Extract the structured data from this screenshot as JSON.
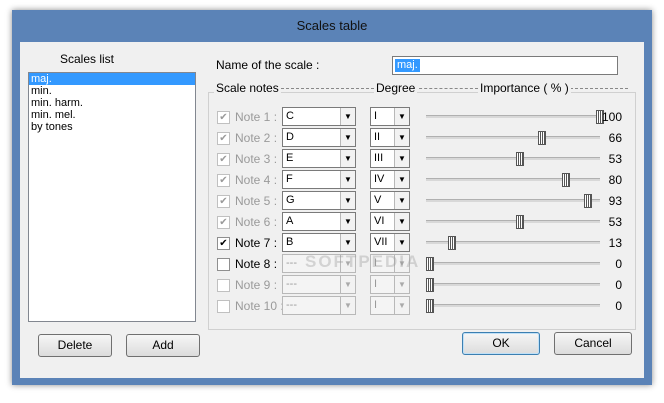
{
  "window": {
    "title": "Scales table"
  },
  "scales_list": {
    "label": "Scales list",
    "items": [
      "maj.",
      "min.",
      "min. harm.",
      "min. mel.",
      "by tones"
    ],
    "selected": 0
  },
  "scale_name": {
    "label": "Name of the scale :",
    "value": "maj."
  },
  "headers": {
    "notes": "Scale notes",
    "degree": "Degree",
    "importance": "Importance ( % )"
  },
  "notes": [
    {
      "label": "Note 1 :",
      "checked": true,
      "label_enabled": false,
      "enabled": true,
      "note": "C",
      "degree": "I",
      "importance": 100
    },
    {
      "label": "Note 2 :",
      "checked": true,
      "label_enabled": false,
      "enabled": true,
      "note": "D",
      "degree": "II",
      "importance": 66
    },
    {
      "label": "Note 3 :",
      "checked": true,
      "label_enabled": false,
      "enabled": true,
      "note": "E",
      "degree": "III",
      "importance": 53
    },
    {
      "label": "Note 4 :",
      "checked": true,
      "label_enabled": false,
      "enabled": true,
      "note": "F",
      "degree": "IV",
      "importance": 80
    },
    {
      "label": "Note 5 :",
      "checked": true,
      "label_enabled": false,
      "enabled": true,
      "note": "G",
      "degree": "V",
      "importance": 93
    },
    {
      "label": "Note 6 :",
      "checked": true,
      "label_enabled": false,
      "enabled": true,
      "note": "A",
      "degree": "VI",
      "importance": 53
    },
    {
      "label": "Note 7 :",
      "checked": true,
      "label_enabled": true,
      "enabled": true,
      "note": "B",
      "degree": "VII",
      "importance": 13
    },
    {
      "label": "Note 8 :",
      "checked": false,
      "label_enabled": true,
      "enabled": false,
      "note": "---",
      "degree": "I",
      "importance": 0
    },
    {
      "label": "Note 9 :",
      "checked": false,
      "label_enabled": false,
      "enabled": false,
      "note": "---",
      "degree": "I",
      "importance": 0
    },
    {
      "label": "Note 10 :",
      "checked": false,
      "label_enabled": false,
      "enabled": false,
      "note": "---",
      "degree": "I",
      "importance": 0
    }
  ],
  "buttons": {
    "delete": "Delete",
    "add": "Add",
    "ok": "OK",
    "cancel": "Cancel"
  },
  "watermark": "SOFTPEDIA"
}
